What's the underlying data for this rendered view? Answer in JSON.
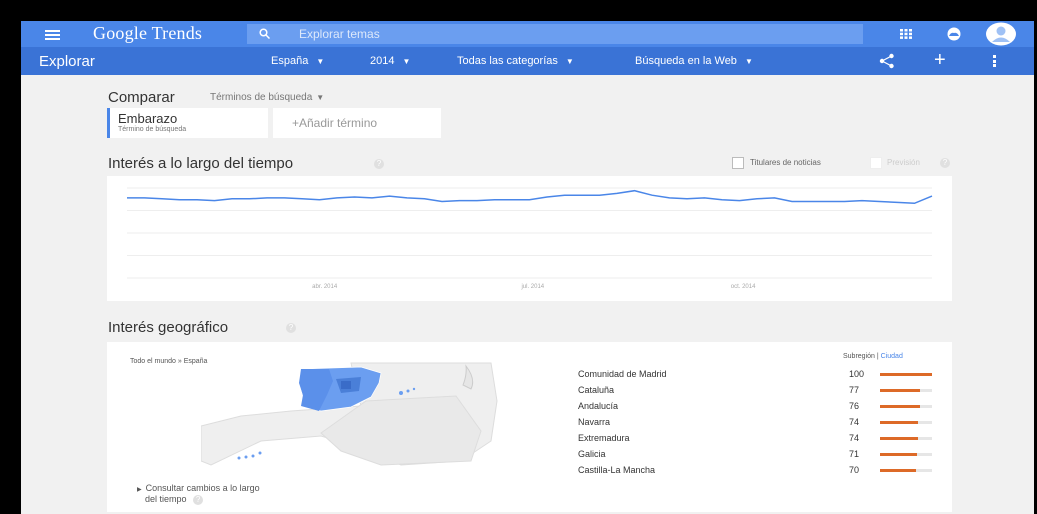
{
  "app": {
    "logo": "Google Trends",
    "search_placeholder": "Explorar temas",
    "page_title": "Explorar"
  },
  "filters": [
    {
      "label": "España"
    },
    {
      "label": "2014"
    },
    {
      "label": "Todas las categorías"
    },
    {
      "label": "Búsqueda en la Web"
    }
  ],
  "compare": {
    "title": "Comparar",
    "subtitle": "Términos de búsqueda",
    "term": {
      "name": "Embarazo",
      "type": "Término de búsqueda",
      "color": "#4a86e8"
    },
    "add_label": "+Añadir término"
  },
  "interest_over_time": {
    "title": "Interés a lo largo del tiempo",
    "options": {
      "headlines": "Titulares de noticias",
      "forecast": "Previsión"
    }
  },
  "chart_data": {
    "type": "line",
    "title": "",
    "xlabel": "",
    "ylabel": "",
    "x_ticks": [
      "abr. 2014",
      "jul. 2014",
      "oct. 2014"
    ],
    "ylim": [
      0,
      100
    ],
    "grid": true,
    "series": [
      {
        "color": "#4a86e8",
        "values": [
          89,
          89,
          88,
          87,
          87,
          86,
          88,
          88,
          89,
          89,
          88,
          87,
          89,
          90,
          89,
          91,
          89,
          88,
          85,
          86,
          86,
          87,
          87,
          87,
          90,
          92,
          92,
          92,
          94,
          97,
          92,
          89,
          88,
          89,
          87,
          86,
          88,
          89,
          85,
          85,
          85,
          85,
          86,
          85,
          84,
          83,
          91
        ]
      }
    ]
  },
  "geo": {
    "title": "Interés geográfico",
    "breadcrumb": "Todo el mundo » España",
    "level_subregion": "Subregión",
    "level_separator": "|",
    "level_city": "Ciudad",
    "accent_color": "#dd6a28",
    "map_color": "#6b9ef0",
    "regions": [
      {
        "name": "Comunidad de Madrid",
        "value": 100
      },
      {
        "name": "Cataluña",
        "value": 77
      },
      {
        "name": "Andalucía",
        "value": 76
      },
      {
        "name": "Navarra",
        "value": 74
      },
      {
        "name": "Extremadura",
        "value": 74
      },
      {
        "name": "Galicia",
        "value": 71
      },
      {
        "name": "Castilla-La Mancha",
        "value": 70
      }
    ],
    "change_link_line1": "Consultar cambios a lo largo",
    "change_link_line2": "del tiempo"
  }
}
